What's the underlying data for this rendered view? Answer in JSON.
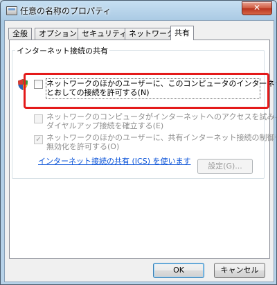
{
  "window": {
    "title": "任意の名称のプロパティ",
    "close_label": "✕"
  },
  "tabs": [
    {
      "label": "全般",
      "active": false
    },
    {
      "label": "オプション",
      "active": false
    },
    {
      "label": "セキュリティ",
      "active": false
    },
    {
      "label": "ネットワーク",
      "active": false
    },
    {
      "label": "共有",
      "active": true
    }
  ],
  "group": {
    "label": "インターネット接続の共有",
    "allow_sharing": {
      "line1": "ネットワークのほかのユーザーに、このコンピュータのインターネット接続を",
      "line2": "とおしての接続を許可する(N)",
      "checked": false
    },
    "dialup": {
      "line1": "ネットワークのコンピュータがインターネットへのアクセスを試みるたびに",
      "line2": "ダイヤルアップ接続を確立する(E)",
      "checked": false,
      "enabled": false
    },
    "control": {
      "line1": "ネットワークのほかのユーザーに、共有インターネット接続の制御や",
      "line2": "無効化を許可する(O)",
      "checked": true,
      "enabled": false
    },
    "ics_link": "インターネット接続の共有 (ICS) を使います",
    "settings_label": "設定(G)..."
  },
  "buttons": {
    "ok": "OK",
    "cancel": "キャンセル"
  },
  "colors": {
    "highlight": "#e41a1a",
    "link": "#0a53d8"
  }
}
